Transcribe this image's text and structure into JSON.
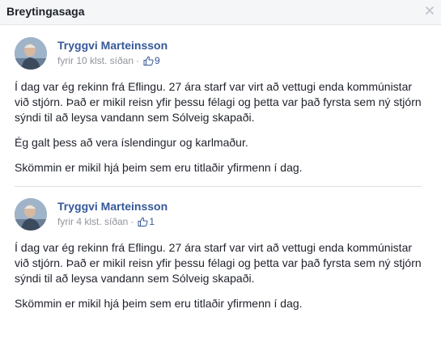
{
  "dialog": {
    "title": "Breytingasaga"
  },
  "revisions": [
    {
      "author": "Tryggvi Marteinsson",
      "time": "fyrir 10 klst. síðan",
      "separator": "·",
      "like_count": "9",
      "paragraphs": [
        "Í dag var ég rekinn frá Eflingu. 27 ára starf var virt að vettugi enda kommúnistar við stjórn. Það er mikil reisn yfir þessu félagi og þetta var það fyrsta sem ný stjórn sýndi til að leysa vandann sem Sólveig skapaði.",
        "Ég galt þess að vera íslendingur og karlmaður.",
        "Skömmin er mikil hjá þeim sem eru titlaðir yfirmenn í dag."
      ]
    },
    {
      "author": "Tryggvi Marteinsson",
      "time": "fyrir 4 klst. síðan",
      "separator": "·",
      "like_count": "1",
      "paragraphs": [
        "Í dag var ég rekinn frá Eflingu. 27 ára starf var virt að vettugi enda kommúnistar við stjórn. Það er mikil reisn yfir þessu félagi og þetta var það fyrsta sem ný stjórn sýndi til að leysa vandann sem Sólveig skapaði.",
        "Skömmin er mikil hjá þeim sem eru titlaðir yfirmenn í dag."
      ]
    }
  ],
  "icons": {
    "close": "close-icon",
    "like": "thumbs-up-icon"
  },
  "colors": {
    "link": "#365899",
    "meta": "#90949c",
    "text": "#1d2129",
    "header_bg": "#f5f6f7"
  }
}
